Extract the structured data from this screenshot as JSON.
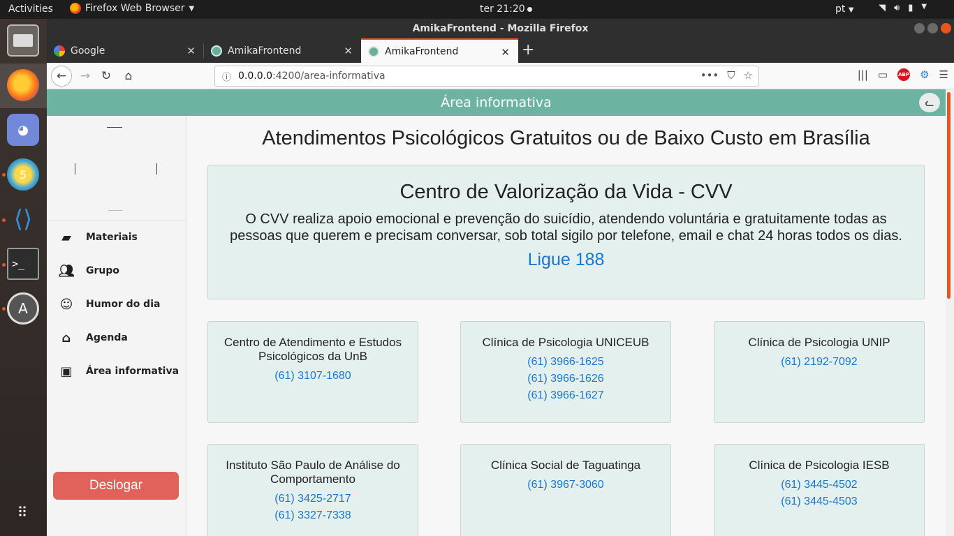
{
  "topbar": {
    "activities": "Activities",
    "app_menu": "Firefox Web Browser",
    "clock": "ter 21:20",
    "language": "pt"
  },
  "window": {
    "title": "AmikaFrontend - Mozilla Firefox"
  },
  "tabs": [
    {
      "label": "Google"
    },
    {
      "label": "AmikaFrontend"
    },
    {
      "label": "AmikaFrontend"
    }
  ],
  "urlbar": {
    "host": "0.0.0.0",
    "path": ":4200/area-informativa"
  },
  "app": {
    "header_title": "Área informativa",
    "menu": [
      {
        "label": "Materiais",
        "icon": "folder-account-icon"
      },
      {
        "label": "Grupo",
        "icon": "group-icon"
      },
      {
        "label": "Humor do dia",
        "icon": "smiley-icon"
      },
      {
        "label": "Agenda",
        "icon": "house-calendar-icon"
      },
      {
        "label": "Área informativa",
        "icon": "contact-card-icon"
      }
    ],
    "logout_label": "Deslogar"
  },
  "content": {
    "page_title": "Atendimentos Psicológicos Gratuitos ou de Baixo Custo em Brasília",
    "cvv": {
      "title": "Centro de Valorização da Vida - CVV",
      "description": "O CVV realiza apoio emocional e prevenção do suicídio, atendendo voluntária e gratuitamente todas as pessoas que querem e precisam conversar, sob total sigilo por telefone, email e chat 24 horas todos os dias.",
      "phone": "Ligue 188"
    },
    "clinics": [
      {
        "name": "Centro de Atendimento e Estudos Psicológicos da UnB",
        "phones": [
          "(61) 3107-1680"
        ]
      },
      {
        "name": "Clínica de Psicologia UNICEUB",
        "phones": [
          "(61) 3966-1625",
          "(61) 3966-1626",
          "(61) 3966-1627"
        ]
      },
      {
        "name": "Clínica de Psicologia UNIP",
        "phones": [
          "(61) 2192-7092"
        ]
      },
      {
        "name": "Instituto São Paulo de Análise do Comportamento",
        "phones": [
          "(61) 3425-2717",
          "(61) 3327-7338"
        ]
      },
      {
        "name": "Clínica Social de Taguatinga",
        "phones": [
          "(61) 3967-3060"
        ]
      },
      {
        "name": "Clínica de Psicologia IESB",
        "phones": [
          "(61) 3445-4502",
          "(61) 3445-4503"
        ]
      }
    ]
  },
  "colors": {
    "header": "#6db3a1",
    "card_bg": "#e4f0ed",
    "link": "#1a76d2",
    "logout": "#e1625a",
    "accent": "#e95420"
  }
}
